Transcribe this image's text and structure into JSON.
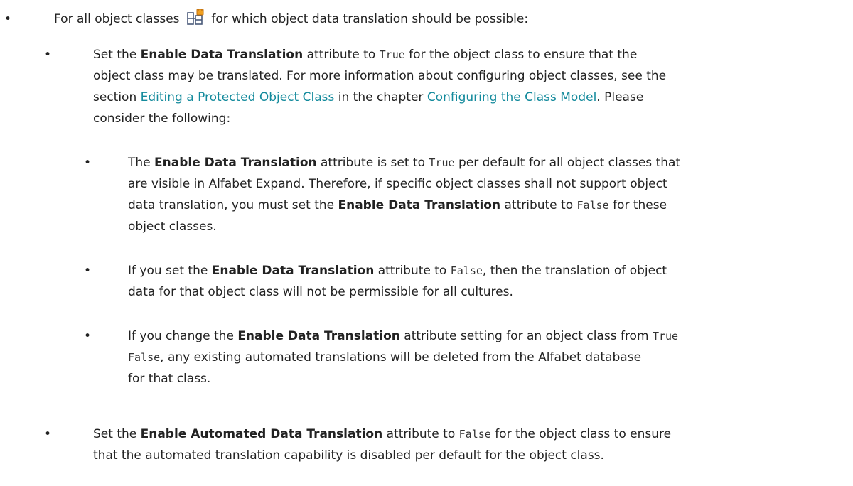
{
  "doc": {
    "item1": {
      "prefix": "For all object classes",
      "icon": "object-class-icon",
      "suffix": "for which object data translation should be possible:"
    },
    "item2": {
      "line1_a": "Set the ",
      "line1_bold": "Enable Data Translation",
      "line1_b": " attribute to ",
      "line1_code": "True",
      "line1_c": " for the object class to ensure that the",
      "line2": "object class may be translated. For more information about configuring object classes, see the",
      "line3_a": "section ",
      "line3_link1": "Editing a Protected Object Class",
      "line3_b": " in the chapter ",
      "line3_link2": "Configuring the Class Model",
      "line3_c": ". Please",
      "line4": "consider the following:"
    },
    "item3": {
      "line1_a": "The ",
      "line1_bold": "Enable Data Translation",
      "line1_b": " attribute is set to ",
      "line1_code": "True",
      "line1_c": " per default for all object classes that",
      "line2": "are visible in Alfabet Expand. Therefore, if specific object classes shall not support object",
      "line3_a": "data translation, you must set the ",
      "line3_bold": "Enable Data Translation",
      "line3_b": " attribute to ",
      "line3_code": "False",
      "line3_c": " for these",
      "line4": "object classes."
    },
    "item4": {
      "line1_a": "If you set the ",
      "line1_bold": "Enable Data Translation",
      "line1_b": " attribute to ",
      "line1_code": "False",
      "line1_c": ", then the translation of object",
      "line2": "data for that object class will not be permissible for all cultures."
    },
    "item5": {
      "line1_a": "If you change the ",
      "line1_bold": "Enable Data Translation",
      "line1_b": " attribute setting for an object class from ",
      "line1_code": "True",
      "line2_code": "False",
      "line2_a": ", any existing automated translations will be deleted from the Alfabet database",
      "line3": "for that class."
    },
    "item6": {
      "line1_a": "Set the ",
      "line1_bold": "Enable Automated Data Translation",
      "line1_b": " attribute to ",
      "line1_code": "False",
      "line1_c": " for the object class to ensure",
      "line2": "that the automated translation capability is disabled per default for the object class."
    },
    "bullet": "•"
  }
}
